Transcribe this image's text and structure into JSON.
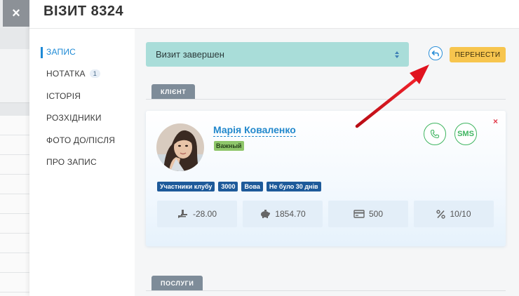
{
  "header": {
    "title": "ВІЗИТ 8324",
    "close_glyph": "×"
  },
  "sidebar": {
    "items": [
      {
        "label": "ЗАПИС",
        "active": true
      },
      {
        "label": "НОТАТКА",
        "badge": "1"
      },
      {
        "label": "ІСТОРІЯ"
      },
      {
        "label": "РОЗХІДНИКИ"
      },
      {
        "label": "ФОТО ДО/ПІСЛЯ"
      },
      {
        "label": "ПРО ЗАПИС"
      }
    ]
  },
  "status": {
    "value": "Визит завершен",
    "icon": "sort-icon"
  },
  "actions": {
    "undo_icon": "undo-icon",
    "move_label": "ПЕРЕНЕСТИ"
  },
  "sections": {
    "client": "КЛІЄНТ",
    "services": "ПОСЛУГИ"
  },
  "client": {
    "name": "Марія Коваленко",
    "tag": "Важный",
    "call_icon": "phone-icon",
    "sms_label": "SMS",
    "remove_glyph": "×",
    "tags": [
      "Участники клубу",
      "3000",
      "Вова",
      "Не було 30 днів"
    ],
    "stats": [
      {
        "icon": "cash-hand-icon",
        "value": "-28.00"
      },
      {
        "icon": "piggy-bank-icon",
        "value": "1854.70"
      },
      {
        "icon": "card-icon",
        "value": "500"
      },
      {
        "icon": "percent-icon",
        "value": "10/10"
      }
    ]
  },
  "colors": {
    "accent": "#1e8ad6",
    "status_bg": "#a9ddd9",
    "move_button": "#f7c54e",
    "tag_green": "#8ec66a",
    "tag_blue": "#1e5a9a",
    "call_green": "#3fb560",
    "remove_red": "#e23b4b",
    "arrow_red": "#e0121e"
  }
}
